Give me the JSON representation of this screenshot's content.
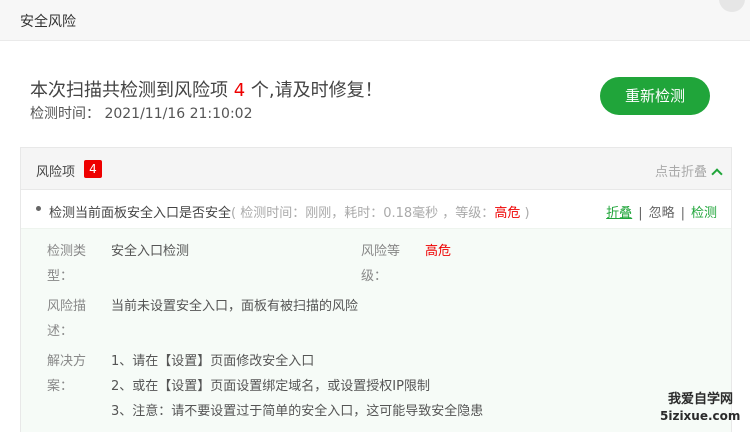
{
  "window": {
    "title": "安全风险"
  },
  "summary": {
    "prefix": "本次扫描共检测到风险项",
    "count": "4",
    "suffix": "个,请及时修复！",
    "scan_time_label": "检测时间：",
    "scan_time": "2021/11/16 21:10:02",
    "recheck_label": "重新检测"
  },
  "panel": {
    "label": "风险项",
    "badge": "4",
    "collapse_label": "点击折叠"
  },
  "item": {
    "name": "检测当前面板安全入口是否安全",
    "meta_open": "( 检测时间：刚刚，耗时：0.18毫秒 ，等级：",
    "level": "高危",
    "meta_close": ")",
    "actions": {
      "fold": "折叠",
      "ignore": "忽略",
      "check": "检测",
      "sep": "|"
    }
  },
  "detail": {
    "type_label_1": "检测类",
    "type_label_2": "型：",
    "type_value": "安全入口检测",
    "level_label_1": "风险等",
    "level_label_2": "级：",
    "level_value": "高危",
    "desc_label_1": "风险描",
    "desc_label_2": "述：",
    "desc_value": "当前未设置安全入口，面板有被扫描的风险",
    "sol_label_1": "解决方",
    "sol_label_2": "案：",
    "solutions": [
      "1、请在【设置】页面修改安全入口",
      "2、或在【设置】页面设置绑定域名，或设置授权IP限制",
      "3、注意：请不要设置过于简单的安全入口，这可能导致安全隐患"
    ]
  },
  "watermark": {
    "line1": "我爱自学网",
    "line2": "5izixue.com"
  },
  "colors": {
    "accent": "#20a53a",
    "danger": "#ee0000"
  }
}
